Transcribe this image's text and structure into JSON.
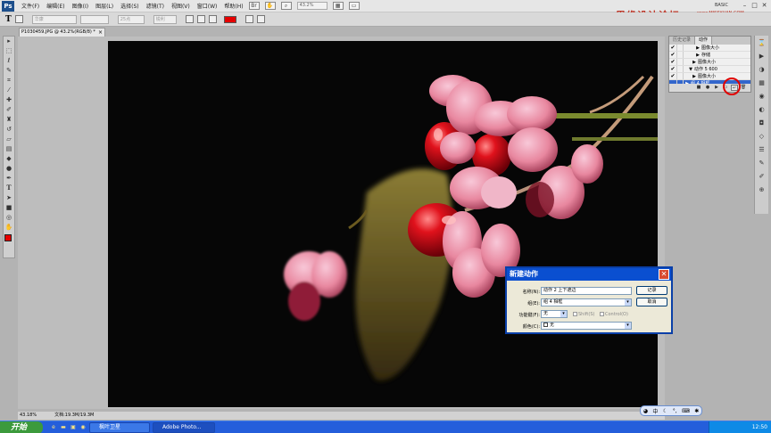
{
  "menubar": {
    "logo": "Ps",
    "items": [
      "文件(F)",
      "编辑(E)",
      "图像(I)",
      "图层(L)",
      "选择(S)",
      "滤镜(T)",
      "视图(V)",
      "窗口(W)",
      "帮助(H)"
    ],
    "zoom": "43.2%",
    "workspace": "BASIC"
  },
  "watermark": {
    "text": "思缘设计论坛",
    "url": "www.MISSYUAN.COM"
  },
  "optionsbar": {
    "tool": "T",
    "font_family": "华康",
    "font_style": "",
    "font_size": "25点",
    "antialias": "锐利",
    "text_color": "#e60000"
  },
  "document": {
    "tab_title": "P1030459.JPG @ 43.2%(RGB/8) *",
    "zoom_status": "43.18%",
    "doc_size": "文档:19.3M/19.3M"
  },
  "actions_panel": {
    "tabs": [
      "历史记录",
      "动作"
    ],
    "rows": [
      {
        "checked": true,
        "indent": 3,
        "label": "图像大小",
        "selected": false
      },
      {
        "checked": true,
        "indent": 3,
        "label": "存储",
        "selected": false
      },
      {
        "checked": true,
        "indent": 2,
        "label": "图像大小",
        "selected": false
      },
      {
        "checked": true,
        "indent": 1,
        "label": "动作 5   600",
        "selected": false
      },
      {
        "checked": true,
        "indent": 2,
        "label": "图像大小",
        "selected": false
      },
      {
        "checked": false,
        "indent": 0,
        "label": "组 4   相框",
        "selected": true
      }
    ]
  },
  "dialog": {
    "title": "新建动作",
    "name_label": "名称(N):",
    "name_value": "动作 2   上下遮边",
    "set_label": "组(E):",
    "set_value": "组 4   相框",
    "fkey_label": "功能键(F):",
    "fkey_value": "无",
    "shift_label": "Shift(S)",
    "control_label": "Control(O)",
    "color_label": "颜色(C):",
    "color_value": "无",
    "record_button": "记录",
    "cancel_button": "取消"
  },
  "ime": {
    "label": "中"
  },
  "taskbar": {
    "start": "开始",
    "buttons": [
      "枫叶卫星",
      "Adobe Photo..."
    ],
    "clock": "12:50"
  },
  "colors": {
    "accent_red": "#e00000",
    "xp_blue": "#245edb",
    "selection_blue": "#3366cc"
  }
}
